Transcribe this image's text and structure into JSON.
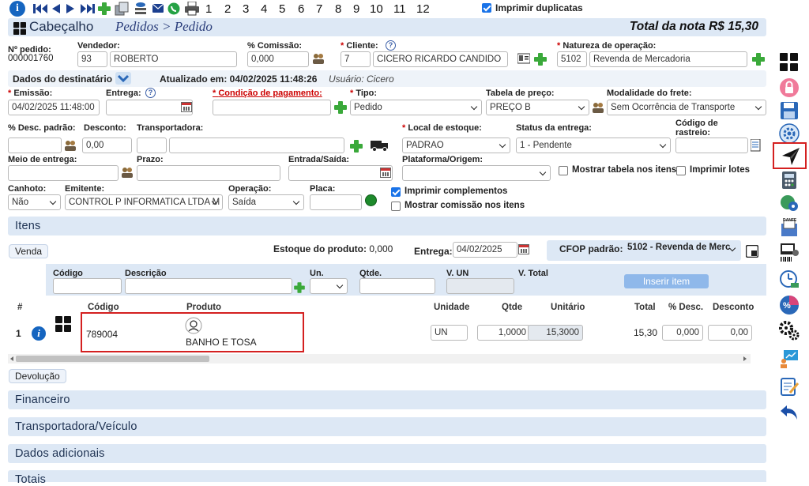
{
  "toolbar": {
    "page_numbers": [
      "1",
      "2",
      "3",
      "4",
      "5",
      "6",
      "7",
      "8",
      "9",
      "10",
      "11",
      "12"
    ],
    "print_duplicates_label": "Imprimir duplicatas",
    "print_duplicates_checked": true
  },
  "header": {
    "section_title": "Cabeçalho",
    "breadcrumb": "Pedidos > Pedido",
    "total_label": "Total da nota R$ 15,30"
  },
  "order": {
    "number_label": "Nº pedido:",
    "number_value": "000001760",
    "seller_label": "Vendedor:",
    "seller_code": "93",
    "seller_name": "ROBERTO",
    "commission_label": "% Comissão:",
    "commission_value": "0,000",
    "client_label": "Cliente:",
    "client_code": "7",
    "client_name": "CICERO RICARDO CANDIDO",
    "nature_label": "Natureza de operação:",
    "nature_code": "5102",
    "nature_name": "Revenda de Mercadoria"
  },
  "recipient": {
    "label": "Dados do destinatário",
    "updated": "Atualizado em: 04/02/2025 11:48:26",
    "user": "Usuário: Cicero"
  },
  "row2": {
    "emission_label": "Emissão:",
    "emission_value": "04/02/2025 11:48:00",
    "delivery_label": "Entrega:",
    "delivery_value": "",
    "payment_label": "Condição de pagamento:",
    "type_label": "Tipo:",
    "type_value": "Pedido",
    "price_table_label": "Tabela de preço:",
    "price_table_value": "PREÇO B",
    "freight_label": "Modalidade do frete:",
    "freight_value": "Sem Ocorrência de Transporte"
  },
  "row3": {
    "discount_std_label": "% Desc. padrão:",
    "discount_label": "Desconto:",
    "discount_value": "0,00",
    "carrier_label": "Transportadora:",
    "stock_label": "Local de estoque:",
    "stock_value": "PADRAO",
    "delivery_status_label": "Status da entrega:",
    "delivery_status_value": "1 - Pendente",
    "tracking_label_1": "Código de",
    "tracking_label_2": "rastreio:"
  },
  "row4": {
    "delivery_means_label": "Meio de entrega:",
    "term_label": "Prazo:",
    "in_out_label": "Entrada/Saída:",
    "platform_label": "Plataforma/Origem:",
    "show_table_label": "Mostrar tabela nos itens",
    "print_batches_label": "Imprimir lotes"
  },
  "row5": {
    "stub_label": "Canhoto:",
    "stub_value": "Não",
    "issuer_label": "Emitente:",
    "issuer_value": "CONTROL P INFORMATICA LTDA M",
    "operation_label": "Operação:",
    "operation_value": "Saída",
    "plate_label": "Placa:",
    "print_complements_label": "Imprimir complementos",
    "show_commission_label": "Mostrar comissão nos itens"
  },
  "items": {
    "section_title": "Itens",
    "sale_button": "Venda",
    "stock_text": "Estoque do produto:",
    "stock_value": "0,000",
    "delivery_label": "Entrega:",
    "delivery_value": "04/02/2025",
    "cfop_label": "CFOP padrão:",
    "cfop_value": "5102 - Revenda de Merc",
    "entry_labels": {
      "code": "Código",
      "description": "Descrição",
      "unit": "Un.",
      "qty": "Qtde.",
      "vun": "V. UN",
      "vtotal": "V. Total"
    },
    "insert_button": "Inserir item",
    "columns": {
      "num": "#",
      "code": "Código",
      "product": "Produto",
      "unit": "Unidade",
      "qty": "Qtde",
      "unit_price": "Unitário",
      "total": "Total",
      "discount_pct": "% Desc.",
      "discount": "Desconto"
    },
    "rows": [
      {
        "num": "1",
        "code": "789004",
        "product": "BANHO E TOSA",
        "unit": "UN",
        "qty": "1,0000",
        "unit_price": "15,3000",
        "total": "15,30",
        "discount_pct": "0,000",
        "discount": "0,00"
      }
    ]
  },
  "footer": {
    "return_button": "Devolução",
    "sections": [
      "Financeiro",
      "Transportadora/Veículo",
      "Dados adicionais",
      "Totais"
    ]
  },
  "colors": {
    "section_bar": "#dde8f5",
    "link_blue": "#2a3d7a",
    "highlight_red": "#d42020",
    "accent_green": "#3aa93a"
  }
}
